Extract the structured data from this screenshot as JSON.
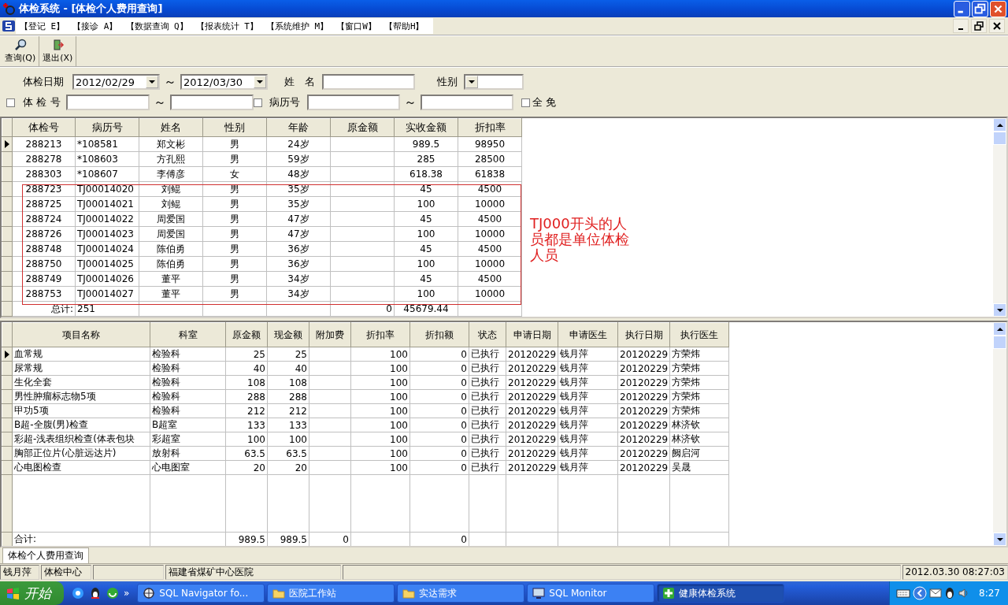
{
  "window": {
    "title": "体检系统 - [体检个人费用查询]"
  },
  "menu": [
    {
      "label": "【登记 E】"
    },
    {
      "label": "【接诊 A】"
    },
    {
      "label": "【数据查询 Q】"
    },
    {
      "label": "【报表统计 T】"
    },
    {
      "label": "【系统维护 M】"
    },
    {
      "label": "【窗口W】"
    },
    {
      "label": "【帮助H】"
    }
  ],
  "toolbar": [
    {
      "label": "查询(Q)",
      "kind": "search"
    },
    {
      "label": "退出(X)",
      "kind": "exit"
    }
  ],
  "filters": {
    "exam_date": {
      "label": "体检日期",
      "from": "2012/02/29",
      "separator": "～",
      "to": "2012/03/30"
    },
    "name": {
      "label": "姓　名"
    },
    "gender": {
      "label": "性别"
    },
    "exam_no": {
      "label": "体 检 号",
      "checked": false,
      "separator": "～"
    },
    "record_no": {
      "label": "病历号",
      "checked": false,
      "separator": "～"
    },
    "all_free": {
      "label": "全 免",
      "checked": false
    }
  },
  "upper_table": {
    "columns": [
      "体检号",
      "病历号",
      "姓名",
      "性别",
      "年龄",
      "原金额",
      "实收金额",
      "折扣率"
    ],
    "rows": [
      {
        "selected": true,
        "exam_no": "288213",
        "record_no": "*108581",
        "name": "郑文彬",
        "gender": "男",
        "age": "24岁",
        "paid": "989.5",
        "discount": "98950"
      },
      {
        "selected": false,
        "exam_no": "288278",
        "record_no": "*108603",
        "name": "方孔熙",
        "gender": "男",
        "age": "59岁",
        "paid": "285",
        "discount": "28500"
      },
      {
        "selected": false,
        "exam_no": "288303",
        "record_no": "*108607",
        "name": "李傅彦",
        "gender": "女",
        "age": "48岁",
        "paid": "618.38",
        "discount": "61838"
      },
      {
        "selected": false,
        "exam_no": "288723",
        "record_no": "TJ00014020",
        "name": "刘鲲",
        "gender": "男",
        "age": "35岁",
        "paid": "45",
        "discount": "4500"
      },
      {
        "selected": false,
        "exam_no": "288725",
        "record_no": "TJ00014021",
        "name": "刘鲲",
        "gender": "男",
        "age": "35岁",
        "paid": "100",
        "discount": "10000"
      },
      {
        "selected": false,
        "exam_no": "288724",
        "record_no": "TJ00014022",
        "name": "周爱国",
        "gender": "男",
        "age": "47岁",
        "paid": "45",
        "discount": "4500"
      },
      {
        "selected": false,
        "exam_no": "288726",
        "record_no": "TJ00014023",
        "name": "周爱国",
        "gender": "男",
        "age": "47岁",
        "paid": "100",
        "discount": "10000"
      },
      {
        "selected": false,
        "exam_no": "288748",
        "record_no": "TJ00014024",
        "name": "陈伯勇",
        "gender": "男",
        "age": "36岁",
        "paid": "45",
        "discount": "4500"
      },
      {
        "selected": false,
        "exam_no": "288750",
        "record_no": "TJ00014025",
        "name": "陈伯勇",
        "gender": "男",
        "age": "36岁",
        "paid": "100",
        "discount": "10000"
      },
      {
        "selected": false,
        "exam_no": "288749",
        "record_no": "TJ00014026",
        "name": "董平",
        "gender": "男",
        "age": "34岁",
        "paid": "45",
        "discount": "4500"
      },
      {
        "selected": false,
        "exam_no": "288753",
        "record_no": "TJ00014027",
        "name": "董平",
        "gender": "男",
        "age": "34岁",
        "paid": "100",
        "discount": "10000"
      }
    ],
    "totals": {
      "label": "总计:",
      "count": "251",
      "original": "0",
      "paid": "45679.44"
    }
  },
  "annotation": {
    "text": "TJ000开头的人员都是单位体检人员"
  },
  "lower_table": {
    "columns": [
      "项目名称",
      "科室",
      "原金额",
      "现金额",
      "附加费",
      "折扣率",
      "折扣额",
      "状态",
      "申请日期",
      "申请医生",
      "执行日期",
      "执行医生"
    ],
    "rows": [
      {
        "selected": true,
        "item": "血常规",
        "dept": "检验科",
        "original": "25",
        "current": "25",
        "rate": "100",
        "discount": "0",
        "status": "已执行",
        "req_date": "20120229",
        "req_doctor": "钱月萍",
        "exec_date": "20120229",
        "exec_doctor": "方荣炜"
      },
      {
        "selected": false,
        "item": "尿常规",
        "dept": "检验科",
        "original": "40",
        "current": "40",
        "rate": "100",
        "discount": "0",
        "status": "已执行",
        "req_date": "20120229",
        "req_doctor": "钱月萍",
        "exec_date": "20120229",
        "exec_doctor": "方荣炜"
      },
      {
        "selected": false,
        "item": "生化全套",
        "dept": "检验科",
        "original": "108",
        "current": "108",
        "rate": "100",
        "discount": "0",
        "status": "已执行",
        "req_date": "20120229",
        "req_doctor": "钱月萍",
        "exec_date": "20120229",
        "exec_doctor": "方荣炜"
      },
      {
        "selected": false,
        "item": "男性肿瘤标志物5项",
        "dept": "检验科",
        "original": "288",
        "current": "288",
        "rate": "100",
        "discount": "0",
        "status": "已执行",
        "req_date": "20120229",
        "req_doctor": "钱月萍",
        "exec_date": "20120229",
        "exec_doctor": "方荣炜"
      },
      {
        "selected": false,
        "item": "甲功5项",
        "dept": "检验科",
        "original": "212",
        "current": "212",
        "rate": "100",
        "discount": "0",
        "status": "已执行",
        "req_date": "20120229",
        "req_doctor": "钱月萍",
        "exec_date": "20120229",
        "exec_doctor": "方荣炜"
      },
      {
        "selected": false,
        "item": "B超-全腹(男)检查",
        "dept": "B超室",
        "original": "133",
        "current": "133",
        "rate": "100",
        "discount": "0",
        "status": "已执行",
        "req_date": "20120229",
        "req_doctor": "钱月萍",
        "exec_date": "20120229",
        "exec_doctor": "林济钦"
      },
      {
        "selected": false,
        "item": "彩超-浅表组织检查(体表包块",
        "dept": "彩超室",
        "original": "100",
        "current": "100",
        "rate": "100",
        "discount": "0",
        "status": "已执行",
        "req_date": "20120229",
        "req_doctor": "钱月萍",
        "exec_date": "20120229",
        "exec_doctor": "林济钦"
      },
      {
        "selected": false,
        "item": "胸部正位片(心脏远达片)",
        "dept": "放射科",
        "original": "63.5",
        "current": "63.5",
        "rate": "100",
        "discount": "0",
        "status": "已执行",
        "req_date": "20120229",
        "req_doctor": "钱月萍",
        "exec_date": "20120229",
        "exec_doctor": "阙启河"
      },
      {
        "selected": false,
        "item": "心电图检查",
        "dept": "心电图室",
        "original": "20",
        "current": "20",
        "rate": "100",
        "discount": "0",
        "status": "已执行",
        "req_date": "20120229",
        "req_doctor": "钱月萍",
        "exec_date": "20120229",
        "exec_doctor": "吴晟"
      }
    ],
    "totals": {
      "label": "合计:",
      "original": "989.5",
      "current": "989.5",
      "surcharge": "0",
      "discount": "0"
    }
  },
  "tabs": [
    {
      "label": "体检个人费用查询",
      "selected": true
    }
  ],
  "status_bar": {
    "user": "钱月萍",
    "department": "体检中心",
    "hospital": "福建省煤矿中心医院",
    "datetime": "2012.03.30 08:27:03"
  },
  "taskbar": {
    "start": "开始",
    "more": "»",
    "tasks": [
      {
        "label": "SQL Navigator fo...",
        "kind": "navigator",
        "selected": false
      },
      {
        "label": "医院工作站",
        "kind": "folder",
        "selected": false
      },
      {
        "label": "实达需求",
        "kind": "folder",
        "selected": false
      },
      {
        "label": "SQL Monitor",
        "kind": "monitor",
        "selected": false
      },
      {
        "label": "健康体检系统",
        "kind": "app",
        "selected": true
      }
    ],
    "clock": "8:27"
  }
}
